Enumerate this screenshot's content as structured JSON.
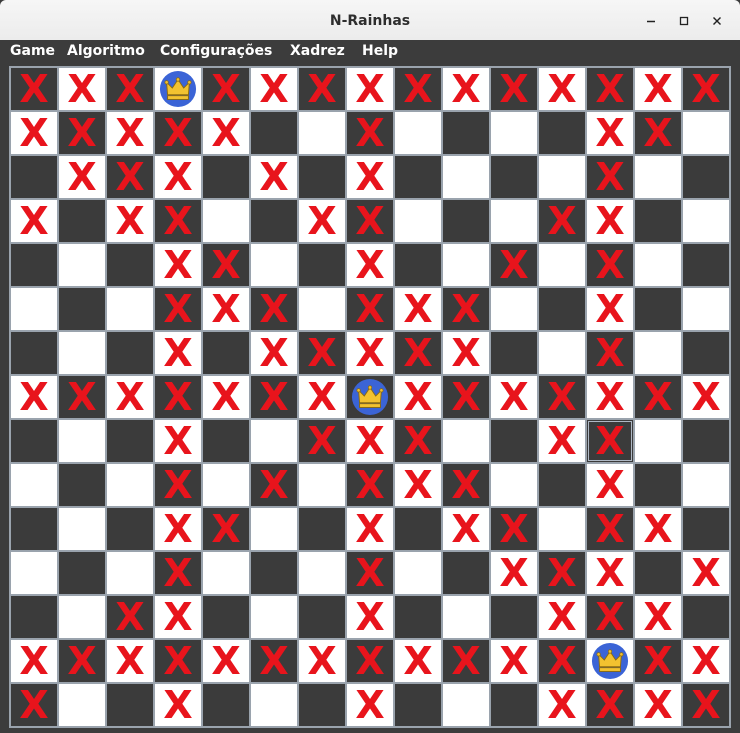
{
  "window": {
    "title": "N-Rainhas",
    "controls": {
      "minimize_icon": "minimize-icon",
      "maximize_icon": "maximize-icon",
      "close_icon": "close-icon"
    }
  },
  "menubar": {
    "items": [
      {
        "label": "Game"
      },
      {
        "label": "Algoritmo"
      },
      {
        "label": "Configurações"
      },
      {
        "label": "Xadrez"
      },
      {
        "label": "Help"
      }
    ]
  },
  "board": {
    "size": 15,
    "dark_color": "#3b3b3b",
    "light_color": "#ffffff",
    "mark_color": "#e8141c",
    "queen_color": "#3b64d6",
    "crown_color": "#f2c230",
    "mark_symbol": "X",
    "legend": "Q = queen-icon, X = attacked square, . = free square",
    "selected_cell": {
      "row": 8,
      "col": 12
    },
    "rows": [
      "XXXQXXXXXXXXXXX",
      "XXXXX..X....XX.",
      ".XXX.X.X....X..",
      "X.XX..XX...XX..",
      "...XX..X..X.X..",
      "...XXX.XXX..X..",
      "...X.XXXXX..X..",
      "XXXXXXXQXXXXXXX",
      "...X..XXX..XX..",
      "...X.X.XXX..X..",
      "...XX..X.XX.XX.",
      "...X...X..XXX.X",
      "..XX...X...XXX.",
      "XXXXXXXXXXXXQXX",
      "X..X...X...XXXX"
    ]
  }
}
